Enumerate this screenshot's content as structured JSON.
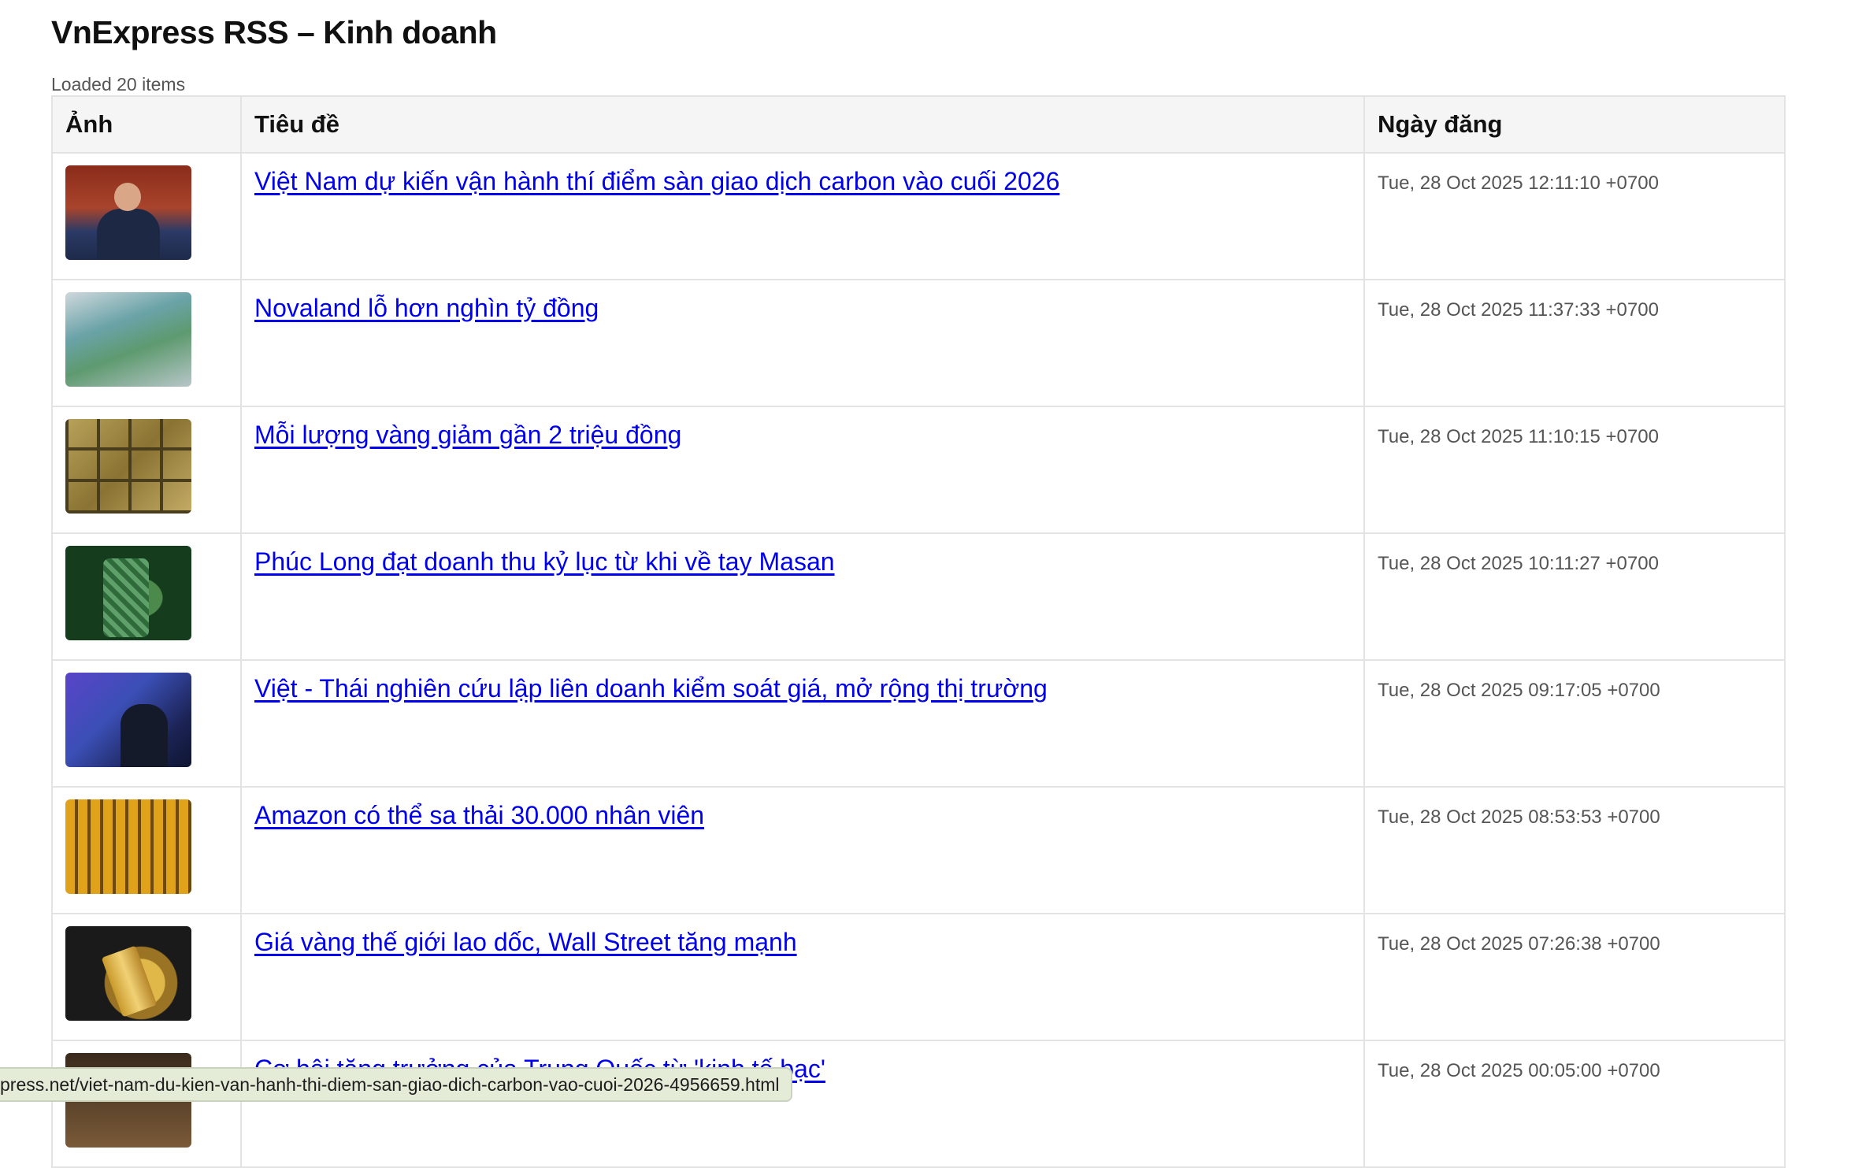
{
  "page": {
    "title": "VnExpress RSS – Kinh doanh",
    "status": "Loaded 20 items"
  },
  "table": {
    "headers": {
      "image": "Ảnh",
      "title": "Tiêu đề",
      "date": "Ngày đăng"
    },
    "rows": [
      {
        "title": "Việt Nam dự kiến vận hành thí điểm sàn giao dịch carbon vào cuối 2026",
        "date": "Tue, 28 Oct 2025 12:11:10 +0700"
      },
      {
        "title": "Novaland lỗ hơn nghìn tỷ đồng",
        "date": "Tue, 28 Oct 2025 11:37:33 +0700"
      },
      {
        "title": "Mỗi lượng vàng giảm gần 2 triệu đồng",
        "date": "Tue, 28 Oct 2025 11:10:15 +0700"
      },
      {
        "title": "Phúc Long đạt doanh thu kỷ lục từ khi về tay Masan",
        "date": "Tue, 28 Oct 2025 10:11:27 +0700"
      },
      {
        "title": "Việt - Thái nghiên cứu lập liên doanh kiểm soát giá, mở rộng thị trường",
        "date": "Tue, 28 Oct 2025 09:17:05 +0700"
      },
      {
        "title": "Amazon có thể sa thải 30.000 nhân viên",
        "date": "Tue, 28 Oct 2025 08:53:53 +0700"
      },
      {
        "title": "Giá vàng thế giới lao dốc, Wall Street tăng mạnh",
        "date": "Tue, 28 Oct 2025 07:26:38 +0700"
      },
      {
        "title": "Cơ hội tăng trưởng của Trung Quốc từ 'kinh tế bạc'",
        "date": "Tue, 28 Oct 2025 00:05:00 +0700"
      }
    ]
  },
  "statusbar": {
    "url": "press.net/viet-nam-du-kien-van-hanh-thi-diem-san-giao-dich-carbon-vao-cuoi-2026-4956659.html"
  },
  "colors": {
    "link": "#0000ee",
    "header_bg": "#f5f5f5",
    "border": "#e3e3e3"
  }
}
